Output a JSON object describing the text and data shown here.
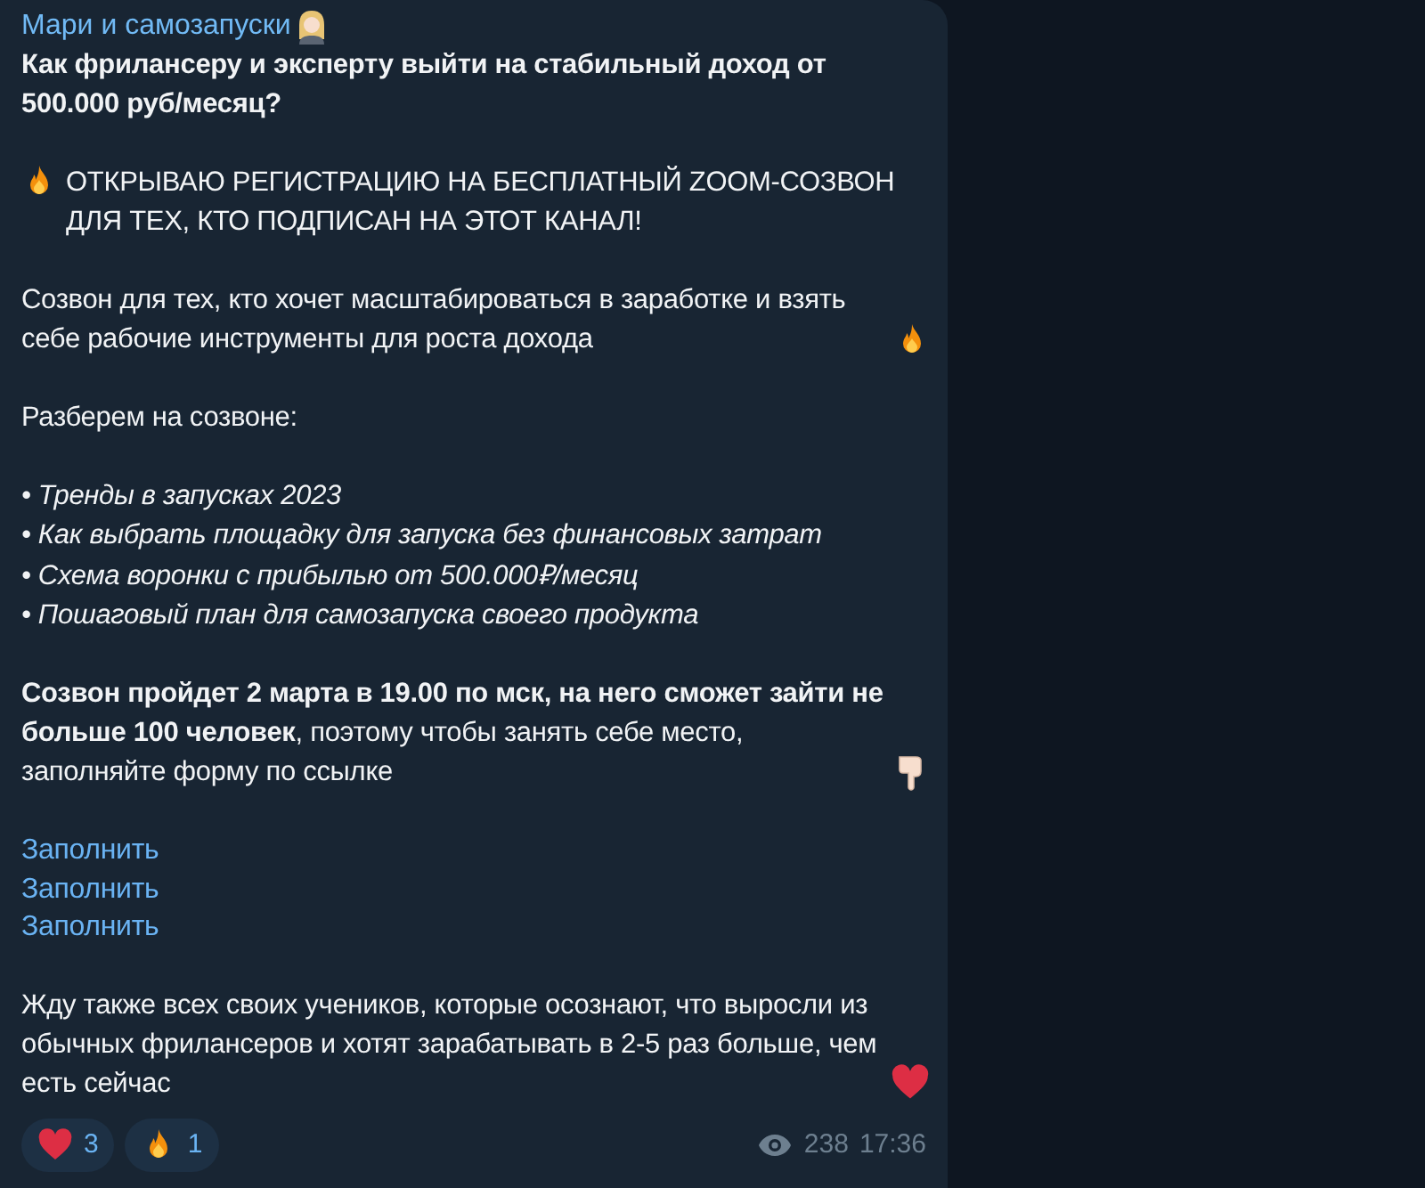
{
  "channel": {
    "name": "Мари и самозапуски"
  },
  "blocks": [
    {
      "kind": "heading",
      "text": "Как фрилансеру и эксперту выйти на стабильный доход от 500.000 руб/месяц?"
    },
    {
      "kind": "announcement",
      "text": "ОТКРЫВАЮ РЕГИСТРАЦИЮ НА БЕСПЛАТНЫЙ ZOOM-СОЗВОН ДЛЯ ТЕХ, КТО ПОДПИСАН НА ЭТОТ КАНАЛ!"
    },
    {
      "kind": "invite",
      "text": "Созвон для тех, кто хочет масштабироваться в заработке и взять себе рабочие инструменты для роста дохода"
    },
    {
      "kind": "plain",
      "text": "Разберем на созвоне:"
    },
    {
      "kind": "list",
      "items": [
        "• Тренды в запусках 2023",
        "• Как выбрать площадку для запуска без финансовых затрат",
        "• Схема воронки с прибылью от 500.000₽/месяц",
        "• Пошаговый план для самозапуска своего продукта"
      ]
    },
    {
      "kind": "cta",
      "text": "**Созвон пройдет 2 марта в 19.00 по мск, на него сможет зайти не больше 100 человек**, поэтому чтобы занять себе место, заполняйте форму по ссылке"
    },
    {
      "kind": "links",
      "items": [
        "Заполнить",
        "Заполнить",
        "Заполнить"
      ]
    },
    {
      "kind": "closing",
      "text": "Жду также всех своих учеников, которые осознают, что выросли из обычных фрилансеров и хотят зарабатывать в 2-5 раз больше, чем есть сейчас"
    }
  ],
  "reactions": [
    {
      "kind": "heart",
      "count": "3"
    },
    {
      "kind": "fire",
      "count": "1"
    }
  ],
  "views": "238",
  "time": "17:36"
}
